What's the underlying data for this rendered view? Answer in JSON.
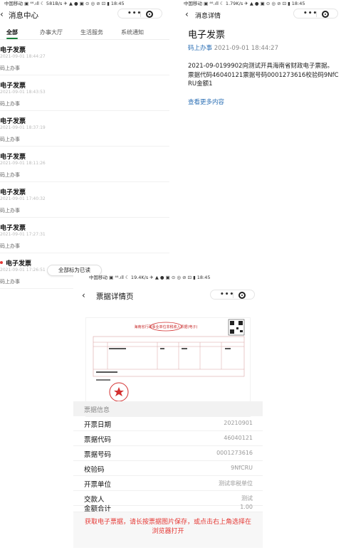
{
  "left_panel": {
    "status": "中国移动 ▣ ⁴⁶.ıll ☾ 581B/s ✈ ▲ ● ▣ ⊙ ◎ ⊘ ⊡ ▮ 18:45",
    "back": "‹",
    "title": "消息中心",
    "tabs": [
      "全部",
      "办事大厅",
      "生活服务",
      "系统通知"
    ],
    "messages": [
      {
        "title": "电子发票",
        "time": "2021-09-01 18:44:27",
        "source": "码上办事"
      },
      {
        "title": "电子发票",
        "time": "2021-09-01 18:43:53",
        "source": "码上办事"
      },
      {
        "title": "电子发票",
        "time": "2021-09-01 18:37:19",
        "source": "码上办事"
      },
      {
        "title": "电子发票",
        "time": "2021-09-01 18:11:26",
        "source": "码上办事"
      },
      {
        "title": "电子发票",
        "time": "2021-09-01 17:40:32",
        "source": "码上办事"
      },
      {
        "title": "电子发票",
        "time": "2021-09-01 17:27:31",
        "source": "码上办事"
      },
      {
        "title": "电子发票",
        "time": "2021-09-01 17:26:51",
        "source": "码上办事"
      }
    ],
    "mark_all_read": "全部标为已读"
  },
  "right_panel": {
    "status": "中国移动 ▣ ⁴⁶.ıll ☾ 1.79K/s ✈ ▲ ● ▣ ⊙ ◎ ⊘ ⊡ ▮ 18:45",
    "back": "‹",
    "title": "消息详情",
    "heading": "电子发票",
    "source": "码上办事",
    "time": "2021-09-01 18:44:27",
    "body": "2021-09-0199902向测试开具海南省财政电子票据。票据代码46040121票据号码0001273616校验码9NfCRU金额1",
    "more": "查看更多内容"
  },
  "bottom_panel": {
    "status": "中国移动 ▣ ⁴⁶.ıll ☾ 19.4K/s ✈ ▲ ● ▣ ⊙ ◎ ⊘ ⊡ ▮ 18:45",
    "back": "‹",
    "title": "票据详情页",
    "invoice_header": "海南省行政事业单位非税收入票据(电子)",
    "section": "票据信息",
    "fields": [
      {
        "label": "开票日期",
        "value": "20210901"
      },
      {
        "label": "票据代码",
        "value": "46040121"
      },
      {
        "label": "票据号码",
        "value": "0001273616"
      },
      {
        "label": "校验码",
        "value": "9NfCRU"
      },
      {
        "label": "开票单位",
        "value": "测试非税单位"
      },
      {
        "label": "交款人",
        "value": "测试"
      },
      {
        "label": "金额合计",
        "value": "1.00"
      }
    ],
    "tip": "获取电子票据，请长按票据图片保存，或点击右上角选择在浏览器打开"
  },
  "capsule": {
    "more": "•••"
  },
  "colors": {
    "accent_green": "#1a7f3c",
    "link_blue": "#2b6fb4",
    "alert_red": "#e53935",
    "stamp_red": "#d32f2f"
  }
}
